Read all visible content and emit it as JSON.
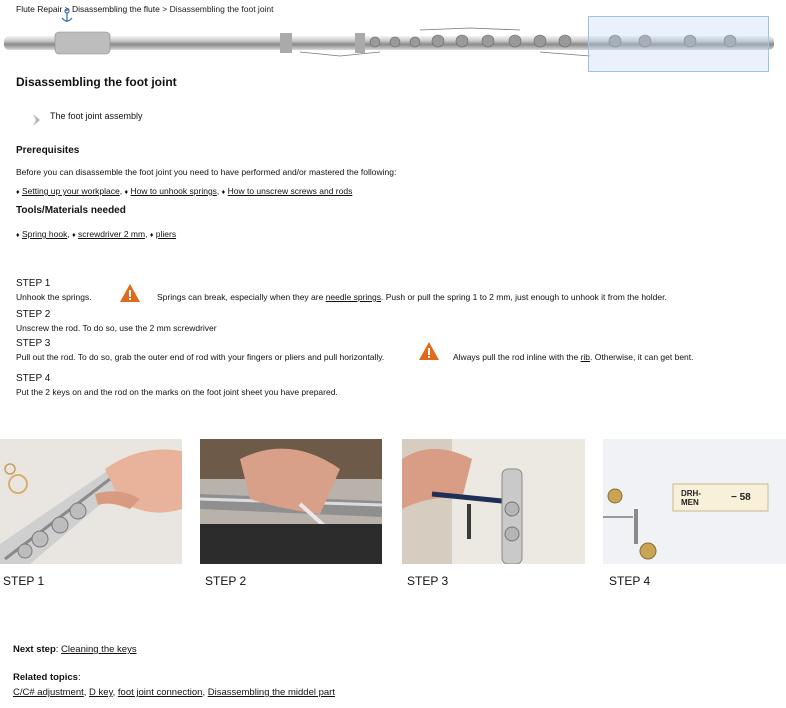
{
  "breadcrumb": {
    "part1": "Flute Repair",
    "sep1": " > ",
    "part2": "Disassembling the flute",
    "sep2": " > ",
    "part3": "Disassembling the foot joint"
  },
  "page_title": "Disassembling the foot joint",
  "sub_item": "The foot joint assembly",
  "prerequisites": {
    "heading": "Prerequisites",
    "intro": "Before you can disassemble the foot joint you need to have performed and/or mastered the following:",
    "links": [
      "Setting up your workplace",
      "How to unhook springs",
      "How to unscrew screws and rods"
    ],
    "bullet": "♦",
    "sep": ", "
  },
  "tools": {
    "heading": "Tools/Materials needed",
    "links": [
      "Spring hook",
      "screwdriver 2 mm",
      "pliers"
    ]
  },
  "steps": [
    {
      "label": "STEP 1",
      "text": "Unhook the springs.",
      "warning_pre": "Springs can break, especially when they are ",
      "warning_link": "needle springs",
      "warning_post": ". Push or pull the spring 1 to 2 mm, just enough to unhook it from the holder."
    },
    {
      "label": "STEP 2",
      "text": "Unscrew the rod. To do so, use the 2 mm screwdriver"
    },
    {
      "label": "STEP 3",
      "text": "Pull out the rod. To do so, grab the outer end of rod with your fingers or pliers and pull horizontally.",
      "warning_pre": "Always pull the rod inline with the ",
      "warning_link": "rib",
      "warning_post": ". Otherwise, it can get bent."
    },
    {
      "label": "STEP 4",
      "text": "Put the 2 keys on and the rod on the marks on the foot joint sheet you have prepared."
    }
  ],
  "photos": [
    {
      "caption": "STEP 1"
    },
    {
      "caption": "STEP 2"
    },
    {
      "caption": "STEP 3"
    },
    {
      "caption": "STEP 4",
      "label_text": "DRH-\nMEN",
      "label_num": "58"
    }
  ],
  "next_step": {
    "label": "Next step",
    "colon": ": ",
    "link": "Cleaning the keys"
  },
  "related": {
    "label": "Related topics",
    "colon": ":",
    "links": [
      "C/C# adjustment",
      "D key",
      "foot joint connection",
      "Disassembling the middel part"
    ]
  },
  "colors": {
    "warning": "#e06a1b",
    "selection": "#9fc3e8",
    "anchor": "#2a6ebb"
  },
  "icons": [
    "anchor-icon",
    "chevron-right-icon",
    "warning-icon"
  ]
}
